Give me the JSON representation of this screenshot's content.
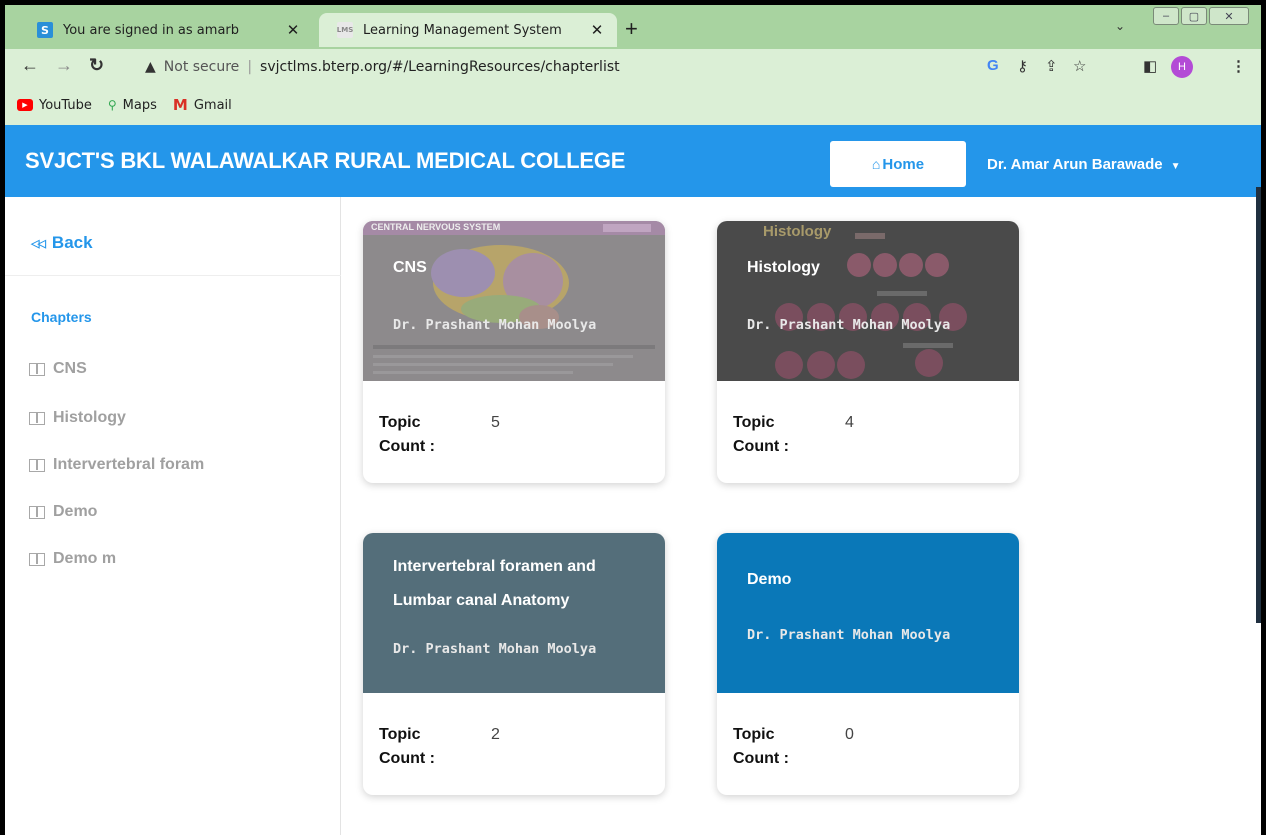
{
  "browser": {
    "tabs": [
      {
        "title": "You are signed in as amarb",
        "favicon": "S"
      },
      {
        "title": "Learning Management System",
        "favicon": "LMS"
      }
    ],
    "new_tab_icon": "+",
    "not_secure": "Not secure",
    "url": "svjctlms.bterp.org/#/LearningResources/chapterlist",
    "profile_initial": "H",
    "bookmarks": [
      {
        "label": "YouTube",
        "icon": "youtube-icon"
      },
      {
        "label": "Maps",
        "icon": "maps-icon"
      },
      {
        "label": "Gmail",
        "icon": "gmail-icon"
      }
    ]
  },
  "header": {
    "college_name": "SVJCT'S BKL WALAWALKAR RURAL MEDICAL COLLEGE",
    "home_label": "Home",
    "user_name": "Dr. Amar Arun Barawade",
    "accent_color": "#2496ea"
  },
  "sidebar": {
    "back_label": "Back",
    "chapters_heading": "Chapters",
    "chapters": [
      "CNS",
      "Histology",
      "Intervertebral foram",
      "Demo",
      "Demo m"
    ]
  },
  "cards": [
    {
      "title": "CNS",
      "author": "Dr. Prashant Mohan Moolya",
      "topic_label": "Topic Count :",
      "topic_count": "5",
      "image_caption": "CENTRAL NERVOUS SYSTEM"
    },
    {
      "title": "Histology",
      "author": "Dr. Prashant Mohan Moolya",
      "topic_label": "Topic Count :",
      "topic_count": "4",
      "image_caption": "Histology"
    },
    {
      "title": "Intervertebral foramen and Lumbar canal Anatomy",
      "author": "Dr. Prashant Mohan Moolya",
      "topic_label": "Topic Count :",
      "topic_count": "2"
    },
    {
      "title": "Demo",
      "author": "Dr. Prashant Mohan Moolya",
      "topic_label": "Topic Count :",
      "topic_count": "0"
    }
  ]
}
